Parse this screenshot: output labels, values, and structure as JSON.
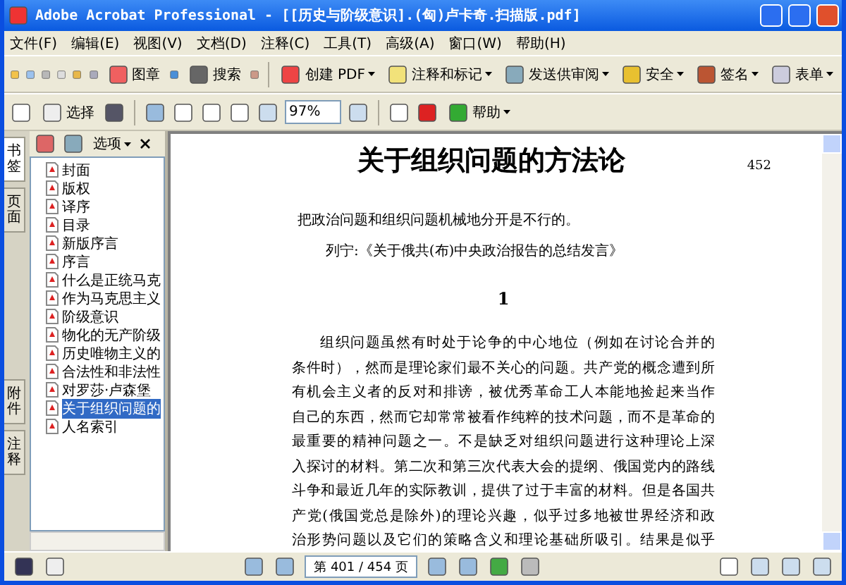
{
  "window": {
    "title": "Adobe Acrobat Professional - [[历史与阶级意识].(匈)卢卡奇.扫描版.pdf]"
  },
  "menu": [
    "文件(F)",
    "编辑(E)",
    "视图(V)",
    "文档(D)",
    "注释(C)",
    "工具(T)",
    "高级(A)",
    "窗口(W)",
    "帮助(H)"
  ],
  "toolbar": {
    "stamp": "图章",
    "search": "搜索",
    "create_pdf": "创建 PDF",
    "comment": "注释和标记",
    "review": "发送供审阅",
    "secure": "安全",
    "sign": "签名",
    "forms": "表单"
  },
  "toolbar2": {
    "select": "选择",
    "zoom": "97%",
    "help": "帮助"
  },
  "sidebar": {
    "tabs": [
      {
        "label": "书签",
        "selected": true
      },
      {
        "label": "页面",
        "selected": false
      },
      {
        "label": "附件",
        "selected": false
      },
      {
        "label": "注释",
        "selected": false
      }
    ],
    "options": "选项",
    "bookmarks": [
      {
        "label": "封面",
        "selected": false
      },
      {
        "label": "版权",
        "selected": false
      },
      {
        "label": "译序",
        "selected": false
      },
      {
        "label": "目录",
        "selected": false
      },
      {
        "label": "新版序言",
        "selected": false
      },
      {
        "label": "序言",
        "selected": false
      },
      {
        "label": "什么是正统马克",
        "selected": false
      },
      {
        "label": "作为马克思主义",
        "selected": false
      },
      {
        "label": "阶级意识",
        "selected": false
      },
      {
        "label": "物化的无产阶级",
        "selected": false
      },
      {
        "label": "历史唯物主义的",
        "selected": false
      },
      {
        "label": "合法性和非法性",
        "selected": false
      },
      {
        "label": "对罗莎·卢森堡",
        "selected": false
      },
      {
        "label": "关于组织问题的",
        "selected": true
      },
      {
        "label": "人名索引",
        "selected": false
      }
    ]
  },
  "document": {
    "title": "关于组织问题的方法论",
    "page_number": "452",
    "epigraph": [
      "把政治问题和组织问题机械地分开是不行的。",
      "列宁:《关于俄共(布)中央政治报告的总结发言》"
    ],
    "section": "1",
    "lines": [
      "组织问题虽然有时处于论争的中心地位（例如在讨论合并的",
      "条件时），然而是理论家们最不关心的问题。共产党的概念遭到所",
      "有机会主义者的反对和排谤，被优秀革命工人本能地捡起来当作",
      "自己的东西，然而它却常常被看作纯粹的技术问题，而不是革命的",
      "最重要的精神问题之一。不是缺乏对组织问题进行这种理论上深",
      "入探讨的材料。第二次和第三次代表大会的提纲、俄国党内的路线",
      "斗争和最近几年的实际教训，提供了过于丰富的材料。但是各国共",
      "产党(俄国党总是除外)的理论兴趣，似乎过多地被世界经济和政",
      "治形势问题以及它们的策略含义和理论基础所吸引。结果是似乎"
    ]
  },
  "nav": {
    "page": "第 401 / 454 页"
  }
}
